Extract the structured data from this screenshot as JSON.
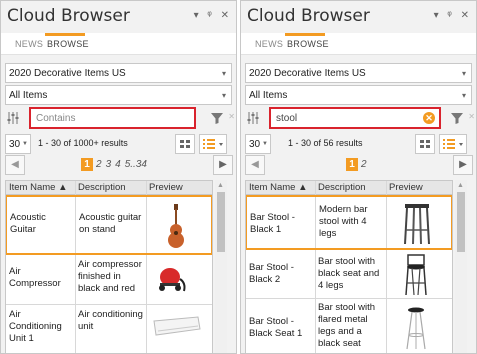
{
  "left": {
    "title": "Cloud Browser",
    "tabs": [
      "NEWS",
      "BROWSE"
    ],
    "catalog": "2020 Decorative Items US",
    "category": "All Items",
    "search": {
      "value": "",
      "placeholder": "Contains"
    },
    "per_page": "30",
    "results": "1 - 30 of 1000+ results",
    "pages": {
      "current": "1",
      "others": [
        "2",
        "3",
        "4",
        "5..",
        "34"
      ]
    },
    "columns": [
      "Item Name ▲",
      "Description",
      "Preview"
    ],
    "rows": [
      {
        "name": "Acoustic Guitar",
        "description": "Acoustic guitar on stand",
        "preview_icon": "guitar-icon"
      },
      {
        "name": "Air Compressor",
        "description": "Air compressor finished in black and red",
        "preview_icon": "air-compressor-icon"
      },
      {
        "name": "Air Conditioning Unit 1",
        "description": "Air conditioning unit",
        "preview_icon": "air-conditioner-icon"
      }
    ]
  },
  "right": {
    "title": "Cloud Browser",
    "tabs": [
      "NEWS",
      "BROWSE"
    ],
    "catalog": "2020 Decorative Items US",
    "category": "All Items",
    "search": {
      "value": "stool",
      "placeholder": ""
    },
    "per_page": "30",
    "results": "1 - 30 of 56 results",
    "pages": {
      "current": "1",
      "others": [
        "2"
      ]
    },
    "columns": [
      "Item Name ▲",
      "Description",
      "Preview"
    ],
    "rows": [
      {
        "name": "Bar Stool - Black 1",
        "description": "Modern bar stool with 4 legs",
        "preview_icon": "bar-stool-icon"
      },
      {
        "name": "Bar Stool - Black 2",
        "description": "Bar stool with black seat and 4 legs",
        "preview_icon": "bar-stool-icon"
      },
      {
        "name": "Bar Stool - Black Seat 1",
        "description": "Bar stool with flared metal legs and a black seat",
        "preview_icon": "bar-stool-icon"
      }
    ]
  },
  "colors": {
    "accent": "#f39b22",
    "highlight": "#d9232d",
    "panel": "#f2f2f2"
  }
}
